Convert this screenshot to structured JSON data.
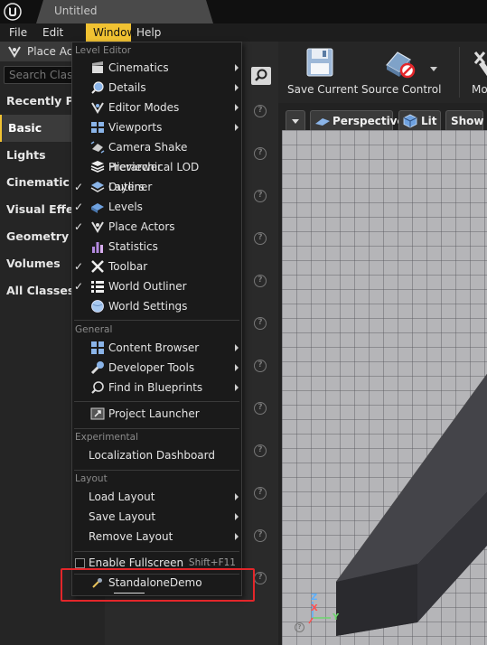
{
  "window": {
    "title": "Untitled"
  },
  "menubar": {
    "items": [
      "File",
      "Edit",
      "Window",
      "Help"
    ],
    "active": "Window"
  },
  "left_panel": {
    "tab_label": "Place Ac",
    "search_placeholder": "Search Class",
    "categories": [
      "Recently Pla",
      "Basic",
      "Lights",
      "Cinematic",
      "Visual Effect",
      "Geometry",
      "Volumes",
      "All Classes"
    ],
    "selected_category": "Basic"
  },
  "toolbar": {
    "save_label": "Save Current",
    "source_control_label": "Source Control",
    "modes_label": "Mo"
  },
  "viewport": {
    "perspective_label": "Perspective",
    "lit_label": "Lit",
    "show_label": "Show",
    "axes": {
      "z": "Z",
      "x": "X",
      "y": "Y"
    }
  },
  "window_menu": {
    "sections": {
      "level_editor": "Level Editor",
      "general": "General",
      "experimental": "Experimental",
      "layout": "Layout"
    },
    "level_editor_items": [
      {
        "label": "Cinematics",
        "checked": false,
        "submenu": true,
        "icon": "clapper-icon"
      },
      {
        "label": "Details",
        "checked": false,
        "submenu": true,
        "icon": "magnifier-icon"
      },
      {
        "label": "Editor Modes",
        "checked": false,
        "submenu": true,
        "icon": "modes-icon"
      },
      {
        "label": "Viewports",
        "checked": false,
        "submenu": true,
        "icon": "viewports-icon"
      },
      {
        "label": "Camera Shake Previewer",
        "checked": false,
        "submenu": false,
        "icon": "camera-shake-icon"
      },
      {
        "label": "Hierarchical LOD Outliner",
        "checked": false,
        "submenu": false,
        "icon": "hlod-icon"
      },
      {
        "label": "Layers",
        "checked": true,
        "submenu": false,
        "icon": "layers-icon"
      },
      {
        "label": "Levels",
        "checked": true,
        "submenu": false,
        "icon": "levels-icon"
      },
      {
        "label": "Place Actors",
        "checked": true,
        "submenu": false,
        "icon": "place-actors-icon"
      },
      {
        "label": "Statistics",
        "checked": false,
        "submenu": false,
        "icon": "statistics-icon"
      },
      {
        "label": "Toolbar",
        "checked": true,
        "submenu": false,
        "icon": "toolbar-icon"
      },
      {
        "label": "World Outliner",
        "checked": true,
        "submenu": false,
        "icon": "world-outliner-icon"
      },
      {
        "label": "World Settings",
        "checked": false,
        "submenu": false,
        "icon": "world-settings-icon"
      }
    ],
    "general_items": [
      {
        "label": "Content Browser",
        "submenu": true,
        "icon": "content-browser-icon"
      },
      {
        "label": "Developer Tools",
        "submenu": true,
        "icon": "developer-tools-icon"
      },
      {
        "label": "Find in Blueprints",
        "submenu": true,
        "icon": "find-blueprints-icon"
      }
    ],
    "project_launcher": "Project Launcher",
    "experimental_items": [
      {
        "label": "Localization Dashboard"
      }
    ],
    "layout_items": [
      {
        "label": "Load Layout",
        "submenu": true
      },
      {
        "label": "Save Layout",
        "submenu": true
      },
      {
        "label": "Remove Layout",
        "submenu": true
      }
    ],
    "fullscreen": {
      "label": "Enable Fullscreen",
      "shortcut": "Shift+F11",
      "checked": false
    },
    "standalone_demo": "StandaloneDemo"
  },
  "colors": {
    "accent": "#f1c232",
    "highlight_box": "#e3262a"
  }
}
